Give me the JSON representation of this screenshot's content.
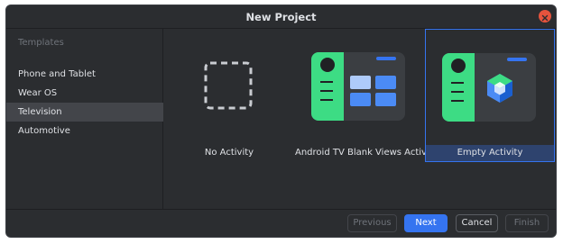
{
  "window": {
    "title": "New Project"
  },
  "sidebar": {
    "header": "Templates",
    "items": [
      {
        "label": "Phone and Tablet",
        "selected": false
      },
      {
        "label": "Wear OS",
        "selected": false
      },
      {
        "label": "Television",
        "selected": true
      },
      {
        "label": "Automotive",
        "selected": false
      }
    ]
  },
  "templates": [
    {
      "label": "No Activity",
      "icon": "dashed-square-icon",
      "selected": false
    },
    {
      "label": "Android TV Blank Views Activity",
      "icon": "tv-blank-views-icon",
      "selected": false
    },
    {
      "label": "Empty Activity",
      "icon": "empty-activity-icon",
      "selected": true
    }
  ],
  "footer": {
    "previous_label": "Previous",
    "next_label": "Next",
    "cancel_label": "Cancel",
    "finish_label": "Finish"
  },
  "colors": {
    "background": "#2b2d30",
    "accent": "#3574f0",
    "green": "#3ddc84",
    "close": "#e5533d",
    "selection": "#43454a"
  }
}
